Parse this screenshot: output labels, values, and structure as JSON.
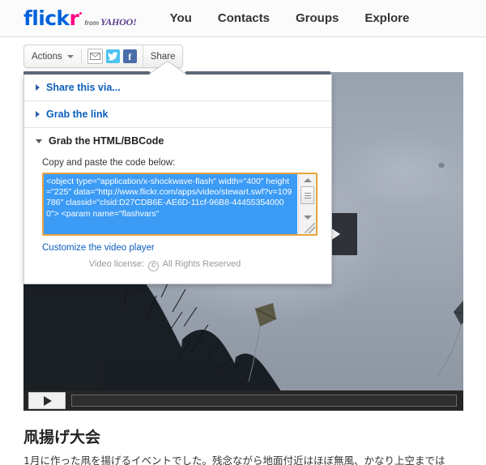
{
  "header": {
    "logo": {
      "part_blue": "flick",
      "part_pink": "r",
      "from": "from",
      "yahoo": "YAHOO!"
    },
    "nav": [
      {
        "label": "You"
      },
      {
        "label": "Contacts"
      },
      {
        "label": "Groups"
      },
      {
        "label": "Explore"
      }
    ]
  },
  "toolbar": {
    "actions_label": "Actions",
    "share_label": "Share",
    "icons": [
      {
        "name": "email-icon",
        "glyph": "✉"
      },
      {
        "name": "twitter-icon",
        "glyph": "🐦"
      },
      {
        "name": "facebook-icon",
        "glyph": "f"
      }
    ]
  },
  "share_panel": {
    "sections": [
      {
        "label": "Share this via...",
        "expanded": false
      },
      {
        "label": "Grab the link",
        "expanded": false
      },
      {
        "label": "Grab the HTML/BBCode",
        "expanded": true
      }
    ],
    "copy_label": "Copy and paste the code below:",
    "code": "<object type=\"application/x-shockwave-flash\" width=\"400\" height=\"225\" data=\"http://www.flickr.com/apps/video/stewart.swf?v=109786\" classid=\"clsid:D27CDB6E-AE6D-11cf-96B8-444553540000\"> <param name=\"flashvars\"",
    "customize_link": "Customize the video player",
    "license_prefix": "Video license:",
    "license_symbol": "©",
    "license_value": "All Rights Reserved"
  },
  "video": {
    "big_play_name": "play-overlay",
    "play_button_name": "play-button",
    "progress_name": "progress-bar"
  },
  "post": {
    "title": "凧揚げ大会",
    "body": "1月に作った凧を揚げるイベントでした。残念ながら地面付近はほぼ無風、かなり上空までは"
  },
  "colors": {
    "flickr_blue": "#0063dc",
    "flickr_pink": "#ff0084",
    "link_blue": "#0c5fbd",
    "selection_blue": "#3b9bf5",
    "focus_orange": "#e8a33d"
  }
}
